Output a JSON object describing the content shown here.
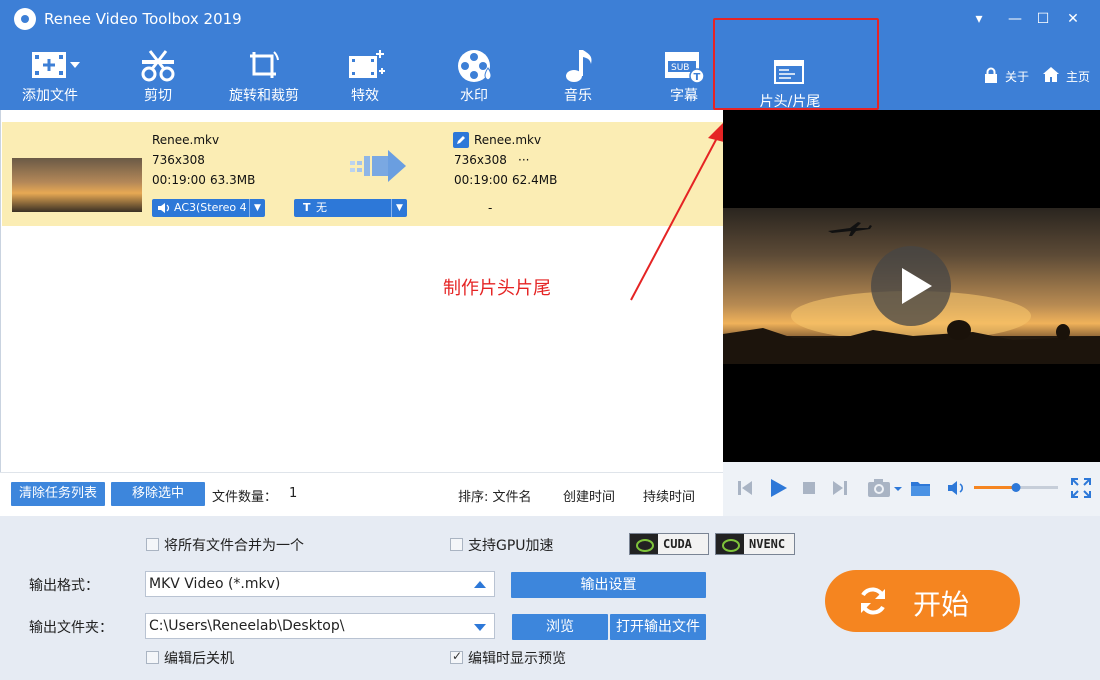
{
  "window": {
    "title": "Renee Video Toolbox 2019",
    "controls": [
      "▾",
      "—",
      "☐",
      "✕"
    ]
  },
  "toolbar": {
    "items": [
      {
        "label": "添加文件",
        "icon": "add-file-icon"
      },
      {
        "label": "剪切",
        "icon": "scissors-icon"
      },
      {
        "label": "旋转和裁剪",
        "icon": "rotate-crop-icon"
      },
      {
        "label": "特效",
        "icon": "effects-icon"
      },
      {
        "label": "水印",
        "icon": "watermark-icon"
      },
      {
        "label": "音乐",
        "icon": "music-note-icon"
      },
      {
        "label": "字幕",
        "icon": "subtitle-icon"
      },
      {
        "label": "片头/片尾",
        "icon": "intro-outro-icon"
      }
    ],
    "about": "关于",
    "home": "主页"
  },
  "task": {
    "source": {
      "name": "Renee.mkv",
      "resolution": "736x308",
      "duration": "00:19:00",
      "size": "63.3MB"
    },
    "output": {
      "name": "Renee.mkv",
      "resolution": "736x308",
      "extra": "···",
      "duration": "00:19:00",
      "size": "62.4MB"
    },
    "audio_track": "AC3(Stereo 4",
    "subtitle": "无",
    "dash": "-"
  },
  "annotation": "制作片头片尾",
  "list_bar": {
    "clear_button": "清除任务列表",
    "remove_button": "移除选中",
    "file_count_label": "文件数量：",
    "file_count": "1",
    "sort_label": "排序: 文件名",
    "sort_created": "创建时间",
    "sort_duration": "持续时间"
  },
  "volume_level": 0.5,
  "settings": {
    "merge_label": "将所有文件合并为一个",
    "merge_checked": false,
    "gpu_label": "支持GPU加速",
    "gpu_checked": false,
    "cuda": "CUDA",
    "nvenc": "NVENC",
    "format_label": "输出格式：",
    "format_value": "MKV Video (*.mkv)",
    "output_settings_button": "输出设置",
    "folder_label": "输出文件夹：",
    "folder_value": "C:\\Users\\Reneelab\\Desktop\\",
    "browse_button": "浏览",
    "open_folder_button": "打开输出文件",
    "shutdown_label": "编辑后关机",
    "shutdown_checked": false,
    "preview_label": "编辑时显示预览",
    "preview_checked": true,
    "start_button": "开始"
  },
  "colors": {
    "brand_blue": "#3d7fd6",
    "row_highlight": "#fbedb4",
    "start_orange": "#f58520",
    "annotation_red": "#e52424"
  }
}
